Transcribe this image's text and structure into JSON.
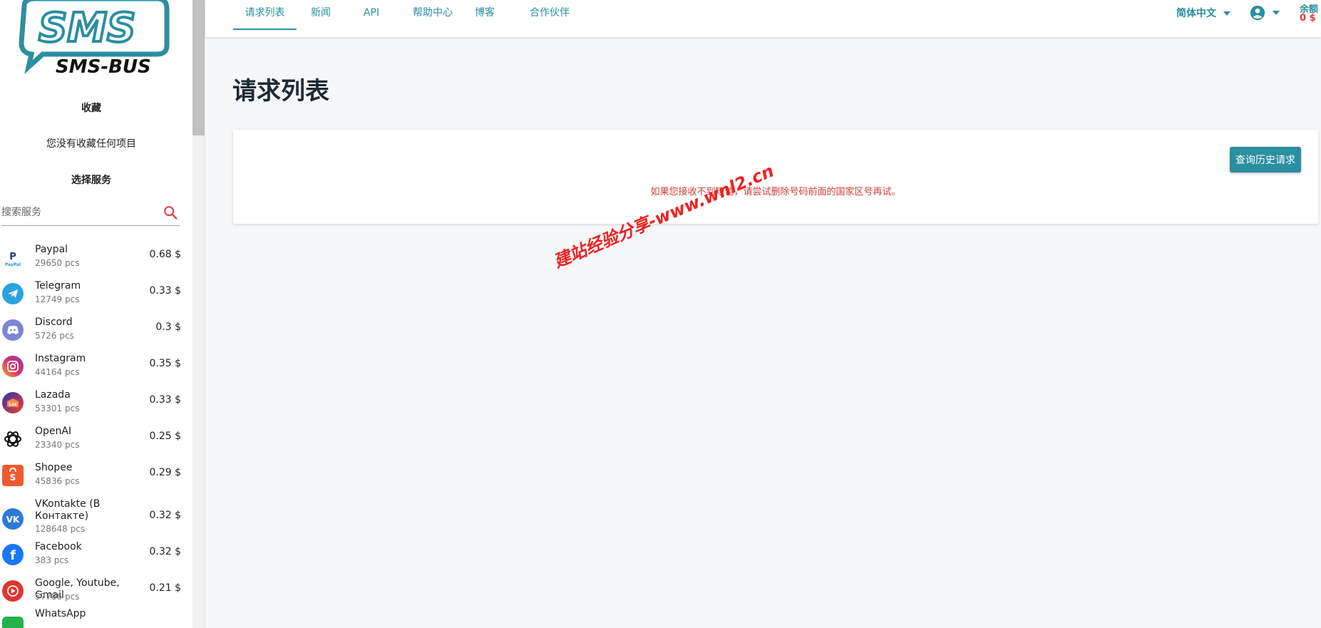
{
  "brand": {
    "logo_top": "SMS",
    "logo_bottom": "SMS-BUS"
  },
  "sidebar": {
    "favorites_title": "收藏",
    "favorites_empty": "您没有收藏任何项目",
    "services_title": "选择服务",
    "search_placeholder": "搜索服务",
    "services": [
      {
        "name": "Paypal",
        "count": "29650 pcs",
        "price": "0.68 $",
        "icon": "paypal-icon",
        "color": "#ffffff"
      },
      {
        "name": "Telegram",
        "count": "12749 pcs",
        "price": "0.33 $",
        "icon": "telegram-icon",
        "color": "#2aa3df"
      },
      {
        "name": "Discord",
        "count": "5726 pcs",
        "price": "0.3 $",
        "icon": "discord-icon",
        "color": "#7b86d8"
      },
      {
        "name": "Instagram",
        "count": "44164 pcs",
        "price": "0.35 $",
        "icon": "instagram-icon",
        "color": "#d6336c"
      },
      {
        "name": "Lazada",
        "count": "53301 pcs",
        "price": "0.33 $",
        "icon": "lazada-icon",
        "color": "#e8513b"
      },
      {
        "name": "OpenAI",
        "count": "23340 pcs",
        "price": "0.25 $",
        "icon": "openai-icon",
        "color": "#ffffff"
      },
      {
        "name": "Shopee",
        "count": "45836 pcs",
        "price": "0.29 $",
        "icon": "shopee-icon",
        "color": "#f05a30"
      },
      {
        "name": "VKontakte (В Контакте)",
        "count": "128648 pcs",
        "price": "0.32 $",
        "icon": "vk-icon",
        "color": "#2c7bd6"
      },
      {
        "name": "Facebook",
        "count": "383 pcs",
        "price": "0.32 $",
        "icon": "facebook-icon",
        "color": "#1877f2"
      },
      {
        "name": "Google, Youtube, Gmail",
        "count": "57786 pcs",
        "price": "0.21 $",
        "icon": "youtube-icon",
        "color": "#e1352d"
      },
      {
        "name": "WhatsApp",
        "count": "",
        "price": "",
        "icon": "whatsapp-icon",
        "color": "#25b14a"
      }
    ]
  },
  "nav": {
    "tabs": [
      "请求列表",
      "新闻",
      "API",
      "帮助中心",
      "博客",
      "合作伙伴"
    ],
    "language": "简体中文",
    "balance_label": "余额",
    "balance_value": "0 $"
  },
  "main": {
    "title": "请求列表",
    "history_button": "查询历史请求",
    "hint": "如果您接收不到短信，请尝试删除号码前面的国家区号再试。"
  },
  "watermark": "建站经验分享-www.wnl2.cn",
  "colors": {
    "accent": "#2a8fa0",
    "danger": "#e23a3a"
  }
}
